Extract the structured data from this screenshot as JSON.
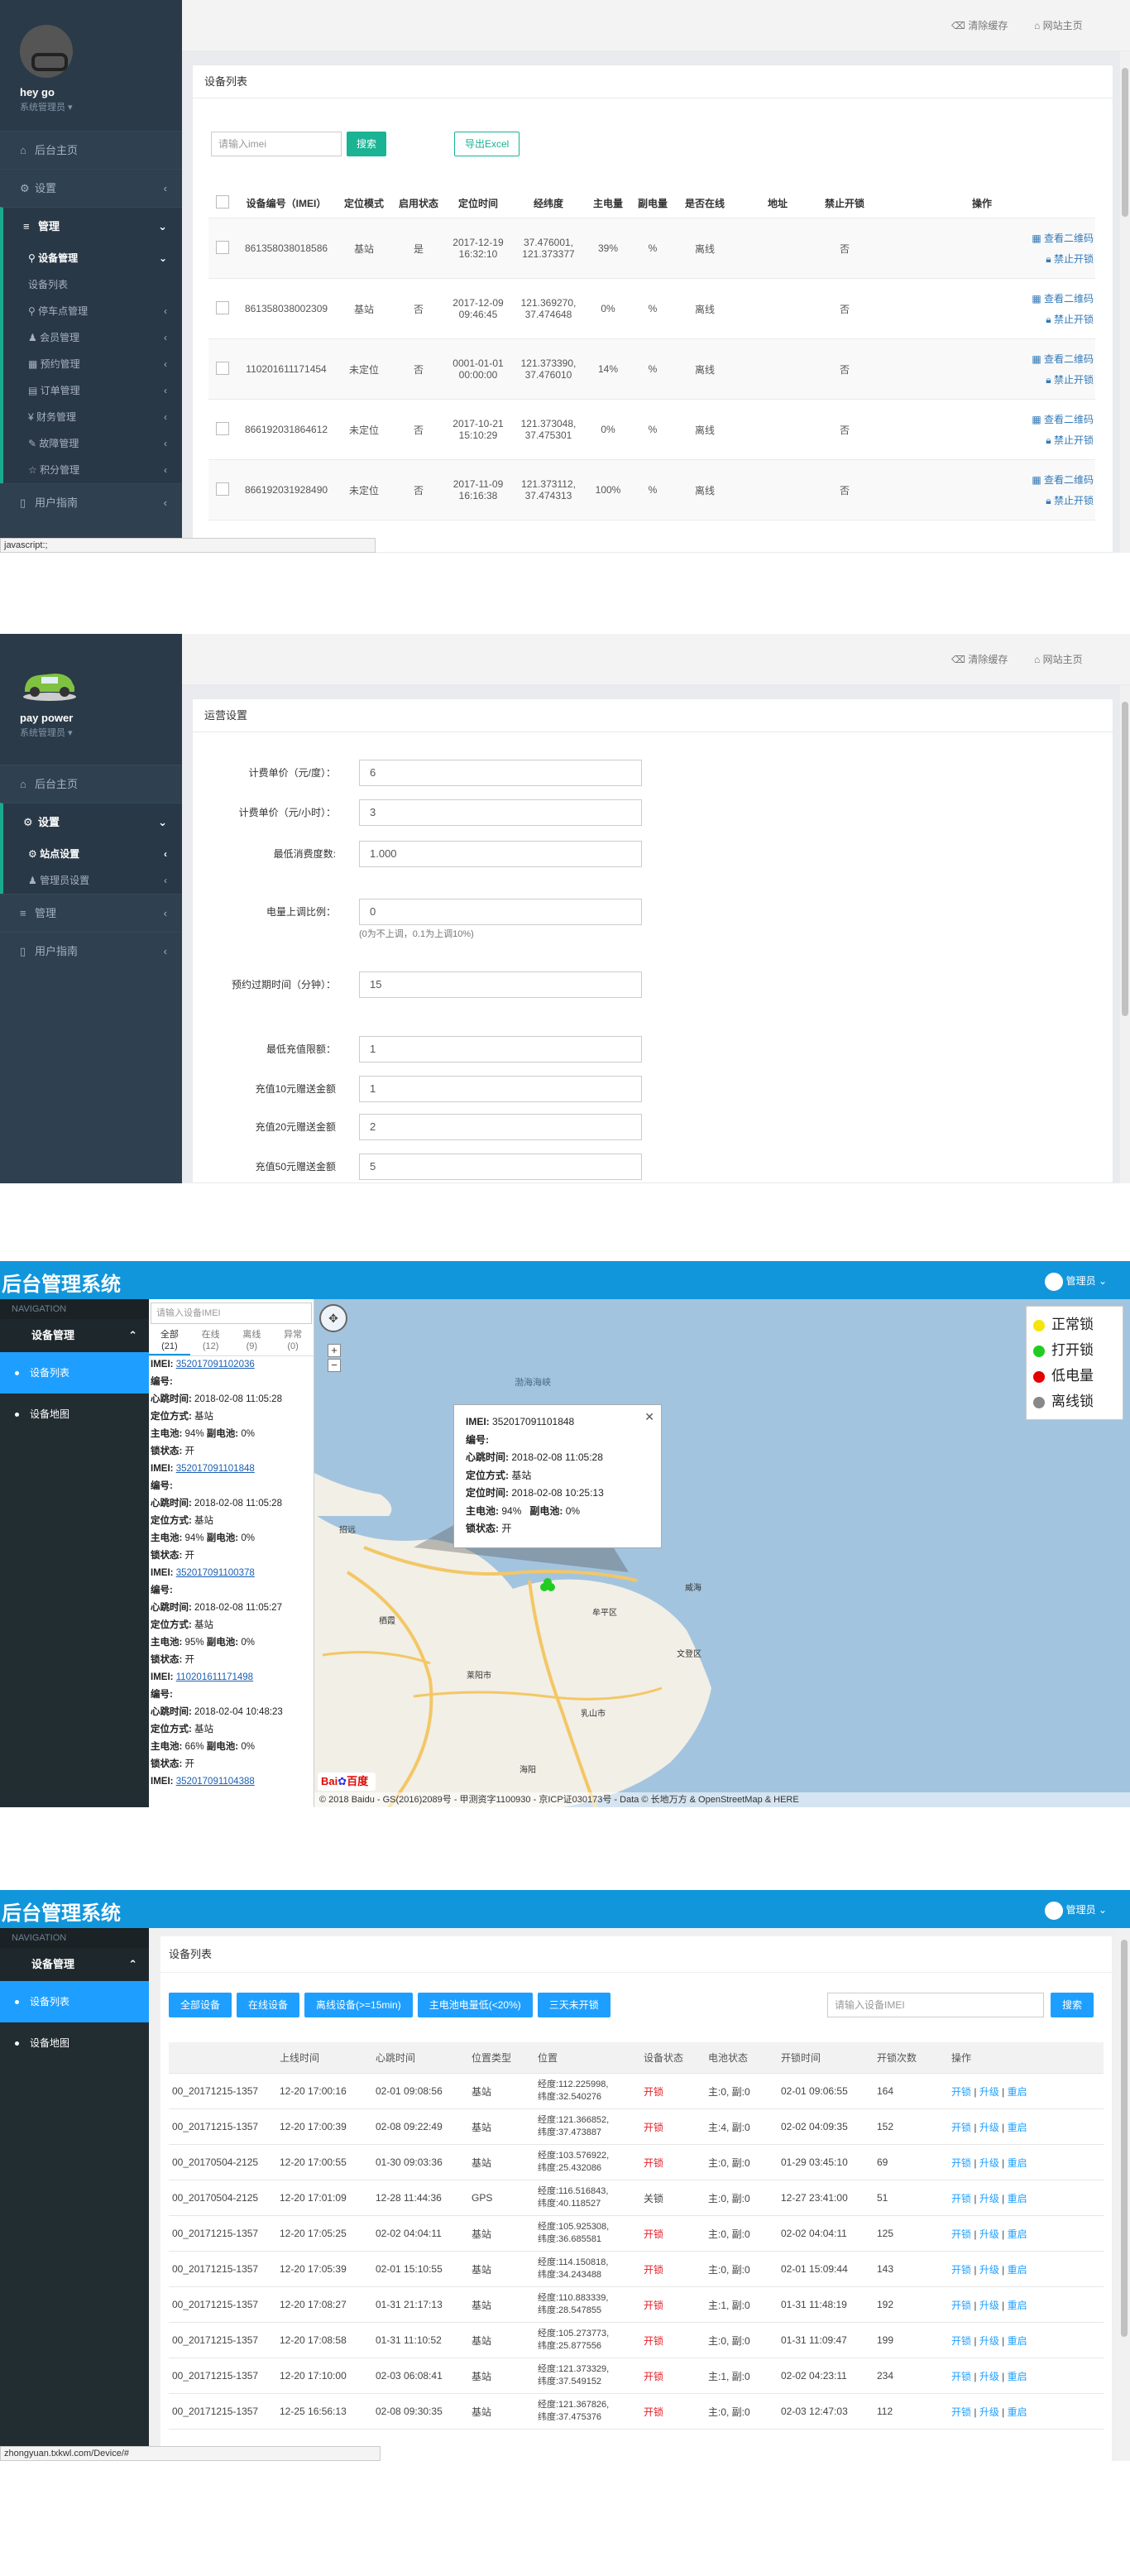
{
  "panel1": {
    "profile": {
      "name": "hey go",
      "role": "系统管理员 ▾"
    },
    "menu": {
      "home": "后台主页",
      "settings": "设置",
      "manage": "管理",
      "device_manage": "设备管理",
      "device_list": "设备列表",
      "parking": "停车点管理",
      "members": "会员管理",
      "booking": "预约管理",
      "orders": "订单管理",
      "finance": "财务管理",
      "faults": "故障管理",
      "points": "积分管理",
      "guide": "用户指南"
    },
    "topbar": {
      "clear_cache": "清除缓存",
      "home": "网站主页"
    },
    "card_title": "设备列表",
    "search_placeholder": "请输入imei",
    "search_btn": "搜索",
    "export_btn": "导出Excel",
    "columns": [
      "设备编号（IMEI）",
      "定位模式",
      "启用状态",
      "定位时间",
      "经纬度",
      "主电量",
      "副电量",
      "是否在线",
      "地址",
      "禁止开锁",
      "操作"
    ],
    "rows": [
      {
        "imei": "861358038018586",
        "mode": "基站",
        "enabled": "是",
        "time": "2017-12-19 16:32:10",
        "coord": "37.476001, 121.373377",
        "main": "39%",
        "sub": "%",
        "online": "离线",
        "addr": "",
        "forbid": "否",
        "op1": "查看二维码",
        "op2": "禁止开锁"
      },
      {
        "imei": "861358038002309",
        "mode": "基站",
        "enabled": "否",
        "time": "2017-12-09 09:46:45",
        "coord": "121.369270, 37.474648",
        "main": "0%",
        "sub": "%",
        "online": "离线",
        "addr": "",
        "forbid": "否",
        "op1": "查看二维码",
        "op2": "禁止开锁"
      },
      {
        "imei": "110201611171454",
        "mode": "未定位",
        "enabled": "否",
        "time": "0001-01-01 00:00:00",
        "coord": "121.373390, 37.476010",
        "main": "14%",
        "sub": "%",
        "online": "离线",
        "addr": "",
        "forbid": "否",
        "op1": "查看二维码",
        "op2": "禁止开锁"
      },
      {
        "imei": "866192031864612",
        "mode": "未定位",
        "enabled": "否",
        "time": "2017-10-21 15:10:29",
        "coord": "121.373048, 37.475301",
        "main": "0%",
        "sub": "%",
        "online": "离线",
        "addr": "",
        "forbid": "否",
        "op1": "查看二维码",
        "op2": "禁止开锁"
      },
      {
        "imei": "866192031928490",
        "mode": "未定位",
        "enabled": "否",
        "time": "2017-11-09 16:16:38",
        "coord": "121.373112, 37.474313",
        "main": "100%",
        "sub": "%",
        "online": "离线",
        "addr": "",
        "forbid": "否",
        "op1": "查看二维码",
        "op2": "禁止开锁"
      }
    ],
    "status_url": "javascript:;"
  },
  "panel2": {
    "profile": {
      "name": "pay power",
      "role": "系统管理员 ▾"
    },
    "menu": {
      "home": "后台主页",
      "settings": "设置",
      "site_settings": "站点设置",
      "admin_settings": "管理员设置",
      "manage": "管理",
      "guide": "用户指南"
    },
    "topbar": {
      "clear_cache": "清除缓存",
      "home": "网站主页"
    },
    "card_title": "运营设置",
    "fields": [
      {
        "label": "计费单价（元/度）：",
        "value": "6"
      },
      {
        "label": "计费单价（元/小时）：",
        "value": "3"
      },
      {
        "label": "最低消费度数:",
        "value": "1.000"
      },
      {
        "label": "电量上调比例：",
        "value": "0"
      },
      {
        "label": "预约过期时间（分钟）：",
        "value": "15"
      },
      {
        "label": "最低充值限额：",
        "value": "1"
      },
      {
        "label": "充值10元赠送金额",
        "value": "1"
      },
      {
        "label": "充值20元赠送金额",
        "value": "2"
      },
      {
        "label": "充值50元赠送金额",
        "value": "5"
      }
    ],
    "ratio_hint": "(0为不上调，0.1为上调10%)"
  },
  "panel3": {
    "title": "后台管理系统",
    "user": "管理员",
    "nav_label": "NAVIGATION",
    "group": "设备管理",
    "items": [
      "设备列表",
      "设备地图"
    ],
    "search_placeholder": "请输入设备IMEI",
    "tabs": [
      {
        "label": "全部",
        "count": "(21)"
      },
      {
        "label": "在线",
        "count": "(12)"
      },
      {
        "label": "离线",
        "count": "(9)"
      },
      {
        "label": "异常",
        "count": "(0)"
      }
    ],
    "devices": [
      {
        "imei": "352017091102036",
        "heartbeat": "2018-02-08 11:05:28",
        "mode": "基站",
        "main": "94%",
        "sub": "0%",
        "lock": "开"
      },
      {
        "imei": "352017091101848",
        "heartbeat": "2018-02-08 11:05:28",
        "mode": "基站",
        "main": "94%",
        "sub": "0%",
        "lock": "开"
      },
      {
        "imei": "352017091100378",
        "heartbeat": "2018-02-08 11:05:27",
        "mode": "基站",
        "main": "95%",
        "sub": "0%",
        "lock": "开"
      },
      {
        "imei": "110201611171498",
        "heartbeat": "2018-02-04 10:48:23",
        "mode": "基站",
        "main": "66%",
        "sub": "0%",
        "lock": "开"
      },
      {
        "imei": "352017091104388",
        "heartbeat": "",
        "mode": "",
        "main": "",
        "sub": "",
        "lock": ""
      }
    ],
    "labels": {
      "imei": "IMEI:",
      "no": "编号:",
      "heartbeat": "心跳时间:",
      "mode": "定位方式:",
      "main": "主电池:",
      "sub": "副电池:",
      "lock": "锁状态:",
      "loctime": "定位时间:"
    },
    "legend": [
      {
        "label": "正常锁",
        "color": "#f5e50a"
      },
      {
        "label": "打开锁",
        "color": "#22cc22"
      },
      {
        "label": "低电量",
        "color": "#e60000"
      },
      {
        "label": "离线锁",
        "color": "#888888"
      }
    ],
    "infowin": {
      "imei": "352017091101848",
      "heartbeat": "2018-02-08 11:05:28",
      "mode": "基站",
      "loctime": "2018-02-08 10:25:13",
      "main": "94%",
      "sub": "0%",
      "lock": "开"
    },
    "map_labels": {
      "sea": "渤海海峡",
      "weihai": "威海",
      "muping": "牟平区",
      "wendeng": "文登区",
      "rushan": "乳山市",
      "laiyang": "莱阳市",
      "qixia": "栖霞",
      "zhaoyuan": "招远",
      "haiyang": "海阳"
    },
    "attribution": "© 2018 Baidu - GS(2016)2089号 - 甲测资字1100930 - 京ICP证030173号 - Data © 长地万方 & OpenStreetMap & HERE"
  },
  "panel4": {
    "title": "后台管理系统",
    "user": "管理员",
    "nav_label": "NAVIGATION",
    "group": "设备管理",
    "items": [
      "设备列表",
      "设备地图"
    ],
    "card_title": "设备列表",
    "filters": [
      "全部设备",
      "在线设备",
      "离线设备(>=15min)",
      "主电池电量低(<20%)",
      "三天未开锁"
    ],
    "search_placeholder": "请输入设备IMEI",
    "search_btn": "搜索",
    "columns": [
      "",
      "上线时间",
      "心跳时间",
      "位置类型",
      "位置",
      "设备状态",
      "电池状态",
      "开锁时间",
      "开锁次数",
      "操作"
    ],
    "rows": [
      {
        "id": "00_20171215-1357",
        "online": "12-20 17:00:16",
        "hb": "02-01 09:08:56",
        "type": "基站",
        "lng": "经度:112.225998,",
        "lat": "纬度:32.540276",
        "state": "开锁",
        "bat": "主:0, 副:0",
        "open": "02-01 09:06:55",
        "count": "164"
      },
      {
        "id": "00_20171215-1357",
        "online": "12-20 17:00:39",
        "hb": "02-08 09:22:49",
        "type": "基站",
        "lng": "经度:121.366852,",
        "lat": "纬度:37.473887",
        "state": "开锁",
        "bat": "主:4, 副:0",
        "open": "02-02 04:09:35",
        "count": "152"
      },
      {
        "id": "00_20170504-2125",
        "online": "12-20 17:00:55",
        "hb": "01-30 09:03:36",
        "type": "基站",
        "lng": "经度:103.576922,",
        "lat": "纬度:25.432086",
        "state": "开锁",
        "bat": "主:0, 副:0",
        "open": "01-29 03:45:10",
        "count": "69"
      },
      {
        "id": "00_20170504-2125",
        "online": "12-20 17:01:09",
        "hb": "12-28 11:44:36",
        "type": "GPS",
        "lng": "经度:116.516843,",
        "lat": "纬度:40.118527",
        "state": "关锁",
        "bat": "主:0, 副:0",
        "open": "12-27 23:41:00",
        "count": "51"
      },
      {
        "id": "00_20171215-1357",
        "online": "12-20 17:05:25",
        "hb": "02-02 04:04:11",
        "type": "基站",
        "lng": "经度:105.925308,",
        "lat": "纬度:36.685581",
        "state": "开锁",
        "bat": "主:0, 副:0",
        "open": "02-02 04:04:11",
        "count": "125"
      },
      {
        "id": "00_20171215-1357",
        "online": "12-20 17:05:39",
        "hb": "02-01 15:10:55",
        "type": "基站",
        "lng": "经度:114.150818,",
        "lat": "纬度:34.243488",
        "state": "开锁",
        "bat": "主:0, 副:0",
        "open": "02-01 15:09:44",
        "count": "143"
      },
      {
        "id": "00_20171215-1357",
        "online": "12-20 17:08:27",
        "hb": "01-31 21:17:13",
        "type": "基站",
        "lng": "经度:110.883339,",
        "lat": "纬度:28.547855",
        "state": "开锁",
        "bat": "主:1, 副:0",
        "open": "01-31 11:48:19",
        "count": "192"
      },
      {
        "id": "00_20171215-1357",
        "online": "12-20 17:08:58",
        "hb": "01-31 11:10:52",
        "type": "基站",
        "lng": "经度:105.273773,",
        "lat": "纬度:25.877556",
        "state": "开锁",
        "bat": "主:0, 副:0",
        "open": "01-31 11:09:47",
        "count": "199"
      },
      {
        "id": "00_20171215-1357",
        "online": "12-20 17:10:00",
        "hb": "02-03 06:08:41",
        "type": "基站",
        "lng": "经度:121.373329,",
        "lat": "纬度:37.549152",
        "state": "开锁",
        "bat": "主:1, 副:0",
        "open": "02-02 04:23:11",
        "count": "234"
      },
      {
        "id": "00_20171215-1357",
        "online": "12-25 16:56:13",
        "hb": "02-08 09:30:35",
        "type": "基站",
        "lng": "经度:121.367826,",
        "lat": "纬度:37.475376",
        "state": "开锁",
        "bat": "主:0, 副:0",
        "open": "02-03 12:47:03",
        "count": "112"
      }
    ],
    "ops": [
      "开锁",
      "升级",
      "重启"
    ],
    "status_url": "zhongyuan.txkwl.com/Device/#"
  }
}
